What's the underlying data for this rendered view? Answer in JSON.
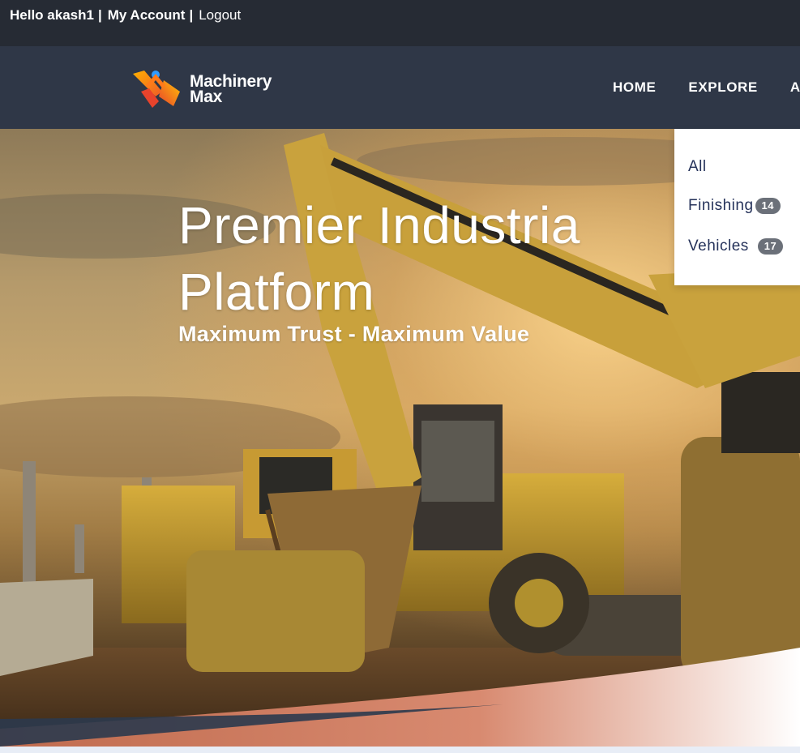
{
  "topbar": {
    "greeting": "Hello akash1",
    "separator": "|",
    "my_account": "My Account",
    "logout": "Logout"
  },
  "brand": {
    "line1": "Machinery",
    "line2": "Max",
    "icon": "machinery-max-logo"
  },
  "nav": {
    "items": [
      "HOME",
      "EXPLORE",
      "A"
    ]
  },
  "hero": {
    "title": "Premier Industria\nPlatform",
    "subtitle": "Maximum Trust - Maximum Value"
  },
  "dropdown": {
    "items": [
      {
        "label": "All",
        "count": ""
      },
      {
        "label": "Finishing",
        "count": "14"
      },
      {
        "label": "Vehicles",
        "count": "17"
      }
    ]
  },
  "colors": {
    "topbar_bg": "#262b34",
    "header_bg": "#2f3747",
    "dropdown_text": "#25325a",
    "badge_bg": "#6b7079",
    "accent_orange": "#f05a28"
  }
}
